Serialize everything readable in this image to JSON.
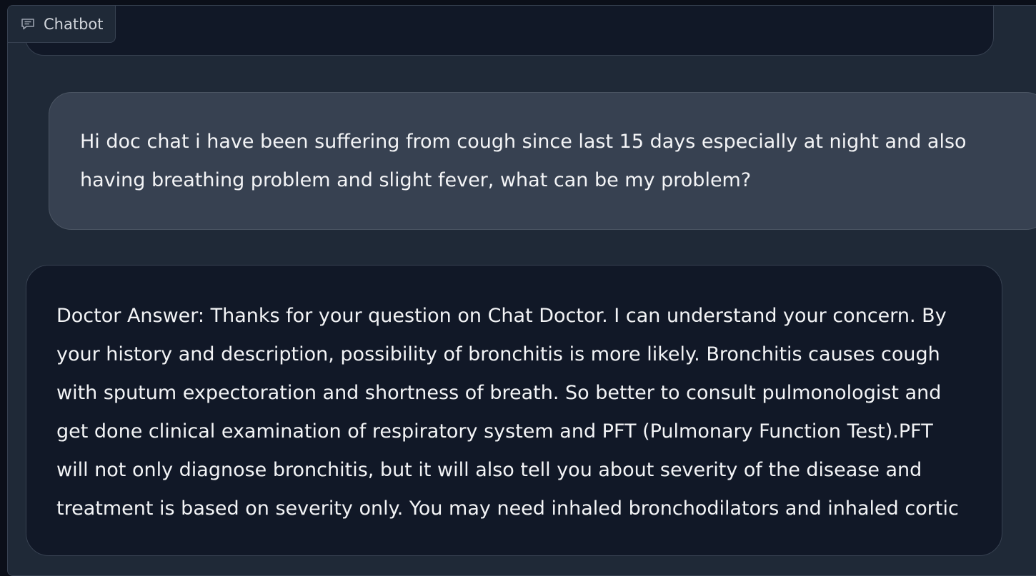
{
  "chatbot": {
    "label": "Chatbot",
    "icon": "chat-bubble-icon",
    "messages": [
      {
        "role": "user",
        "text": "Hi doc chat i have been suffering from cough since last 15 days especially at night and also having breathing problem and slight fever, what can be my problem?"
      },
      {
        "role": "bot",
        "lines": [
          "Doctor Answer: Thanks for your question on Chat Doctor. I can understand your concern. By",
          "your history and description, possibility of bronchitis is more likely. Bronchitis causes cough",
          "with sputum expectoration and shortness of breath. So better to consult pulmonologist and",
          "get done clinical examination of respiratory system and PFT (Pulmonary Function Test).PFT",
          "will not only diagnose bronchitis, but it will also tell you about severity of the disease and",
          "treatment is based on severity only. You may need inhaled bronchodilators and inhaled cortic"
        ]
      }
    ]
  },
  "colors": {
    "page_bg": "#0b0f19",
    "panel_bg": "#1f2937",
    "user_bubble_bg": "#374151",
    "bot_bubble_bg": "#111827",
    "text": "#f3f4f6"
  }
}
